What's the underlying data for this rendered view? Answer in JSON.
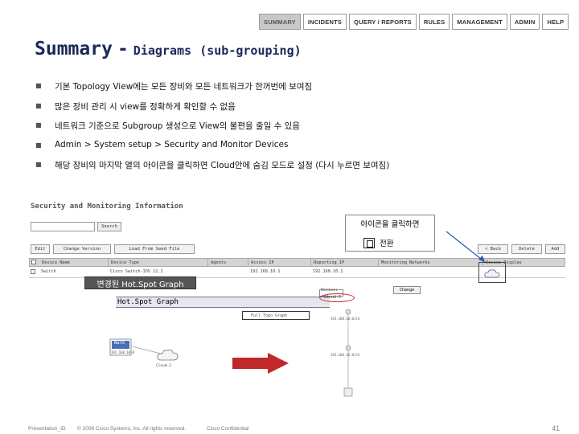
{
  "nav": {
    "tabs": [
      {
        "label": "SUMMARY",
        "active": true
      },
      {
        "label": "INCIDENTS",
        "active": false
      },
      {
        "label": "QUERY / REPORTS",
        "active": false
      },
      {
        "label": "RULES",
        "active": false
      },
      {
        "label": "MANAGEMENT",
        "active": false
      },
      {
        "label": "ADMIN",
        "active": false
      },
      {
        "label": "HELP",
        "active": false
      }
    ]
  },
  "title": {
    "main": "Summary",
    "sep": "-",
    "sub_a": "Diagrams",
    "sub_b": "(sub-grouping)"
  },
  "bullets": [
    "기본 Topology View에는 모든 장비와 모든 네트워크가 한꺼번에 보여짐",
    "많은 장비 관리 시 view를 정확하게 확인할 수 없음",
    "네트워크 기준으로 Subgroup 생성으로 View의 불편을 줄일 수 있음",
    "Admin > System setup > Security and Monitor Devices",
    "해당 장비의 마지막 열의 아이콘을 클릭하면 Cloud안에 숨김 모드로 설정 (다시 누르면 보여짐)"
  ],
  "screenshot": {
    "section_title": "Security and Monitoring Information",
    "search_button": "Search",
    "toolbar": {
      "edit": "Edit",
      "change_version": "Change Version",
      "load_seed": "Load From Seed File",
      "back": "< Back",
      "delete": "Delete",
      "add": "Add"
    },
    "columns": [
      "Device Name",
      "Device Type",
      "Agents",
      "Access IP",
      "Reporting IP",
      "Monitoring Networks",
      "Device Display"
    ],
    "row": {
      "name": "Switch",
      "type": "Cisco Switch-IOS 12.2",
      "access_ip": "192.168.10.1",
      "reporting_ip": "192.168.10.1"
    },
    "callout_line1": "아이콘을 클릭하면",
    "callout_line2": "전환",
    "changed_label": "변경된 Hot.Spot Graph",
    "hotspot_title": "Hot.Spot Graph",
    "hotspot_input": "Full Topo Graph",
    "node_nat": "Nat5",
    "node_nat_sub": "192.168.10.0",
    "node_cloud": "Cloud-2",
    "right_device": "Device:",
    "right_change": "Change",
    "right_cloud": "Cloud-2",
    "tree_top": "192.168.10.0/24",
    "tree_mid": "192.168.10.0/24"
  },
  "footer": {
    "left": "Presentation_ID",
    "copyright": "© 2006 Cisco Systems, Inc. All rights reserved.",
    "confidential": "Cisco Confidential",
    "page": "41"
  },
  "colors": {
    "title": "#1a2a5a",
    "arrow": "#c0282a",
    "hotspot_bar": "#e8e4f2",
    "changed_label_bg": "#555555"
  }
}
